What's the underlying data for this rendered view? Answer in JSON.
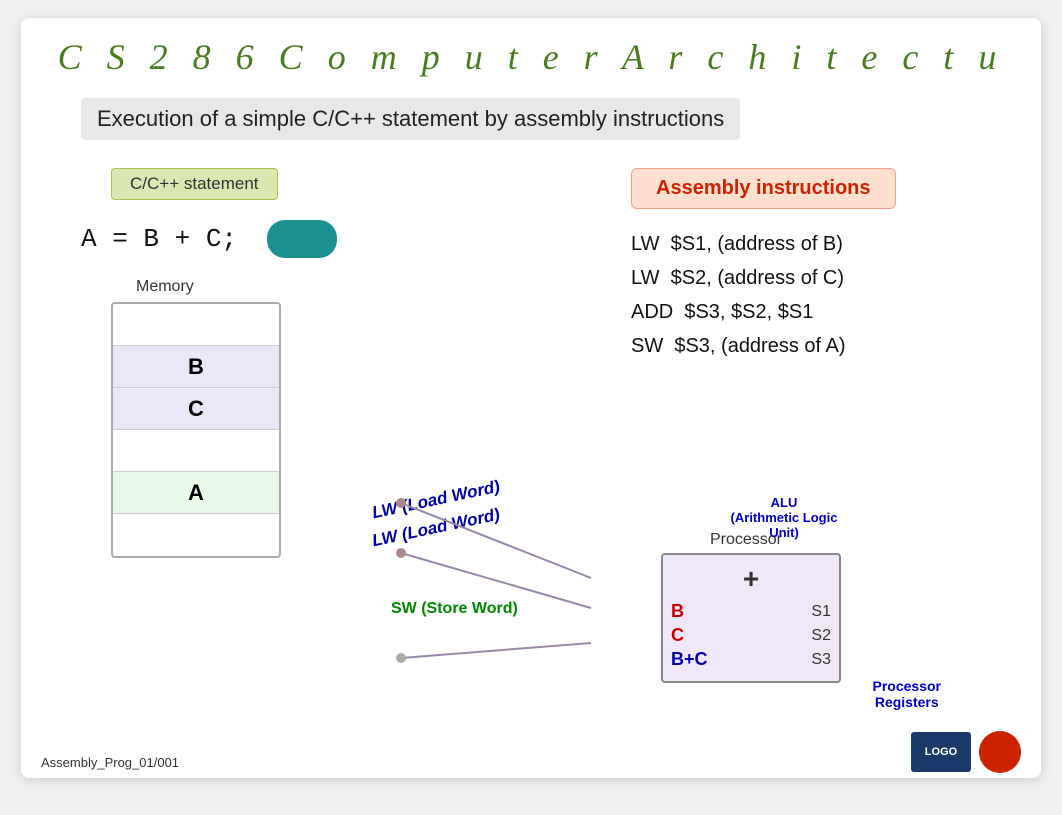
{
  "title": "C S   2 8 6   C o m p u t e r   A r c h i t e c t u",
  "subtitle": "Execution of a simple C/C++ statement by assembly instructions",
  "cpp_label": "C/C++ statement",
  "asm_label": "Assembly instructions",
  "cpp_statement": "A = B + C;",
  "memory_label": "Memory",
  "memory_cells": [
    {
      "id": "cell-empty1",
      "value": ""
    },
    {
      "id": "cell-B",
      "value": "B",
      "highlight": "b"
    },
    {
      "id": "cell-C",
      "value": "C",
      "highlight": "c"
    },
    {
      "id": "cell-empty2",
      "value": ""
    },
    {
      "id": "cell-A",
      "value": "A",
      "highlight": "a"
    },
    {
      "id": "cell-empty3",
      "value": ""
    }
  ],
  "asm_lines": [
    "LW  $S1, (address of B)",
    "LW  $S2, (address of C)",
    "ADD  $S3, $S2, $S1",
    "SW  $S3, (address of A)"
  ],
  "processor_label": "Processor",
  "alu_label": "ALU\n(Arithmetic Logic\nUnit)",
  "plus_sign": "+",
  "registers": [
    {
      "value": "B",
      "color": "red",
      "name": "S1"
    },
    {
      "value": "C",
      "color": "red",
      "name": "S2"
    },
    {
      "value": "B+C",
      "color": "blue",
      "name": "S3"
    }
  ],
  "proc_registers_label": "Processor\nRegisters",
  "lw_labels": [
    "LW (Load Word)",
    "LW (Load Word)"
  ],
  "sw_label": "SW (Store Word)",
  "bottom_label": "Assembly_Prog_01/001"
}
